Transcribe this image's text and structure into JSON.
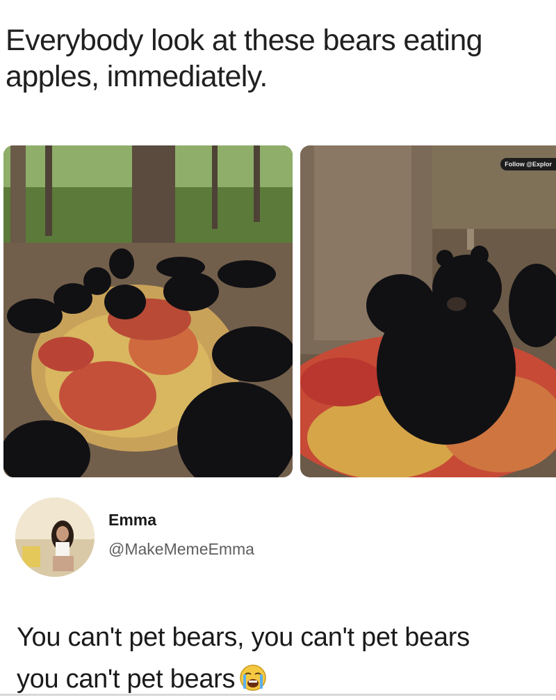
{
  "post": {
    "caption": "Everybody look at these bears eating apples, immediately.",
    "watermark": "Follow @Explor"
  },
  "reply": {
    "author_name": "Emma",
    "author_handle": "@MakeMemeEmma",
    "line1": "You can't pet bears, you can't pet bears",
    "line2": "you can't pet bears",
    "emoji": "crying-face-emoji"
  },
  "colors": {
    "text": "#1a1a1a",
    "handle": "#5e5e5e",
    "bear": "#111114",
    "apple_red": "#c23a2e",
    "apple_yellow": "#d9b24a",
    "forest_floor": "#6e5a45"
  }
}
